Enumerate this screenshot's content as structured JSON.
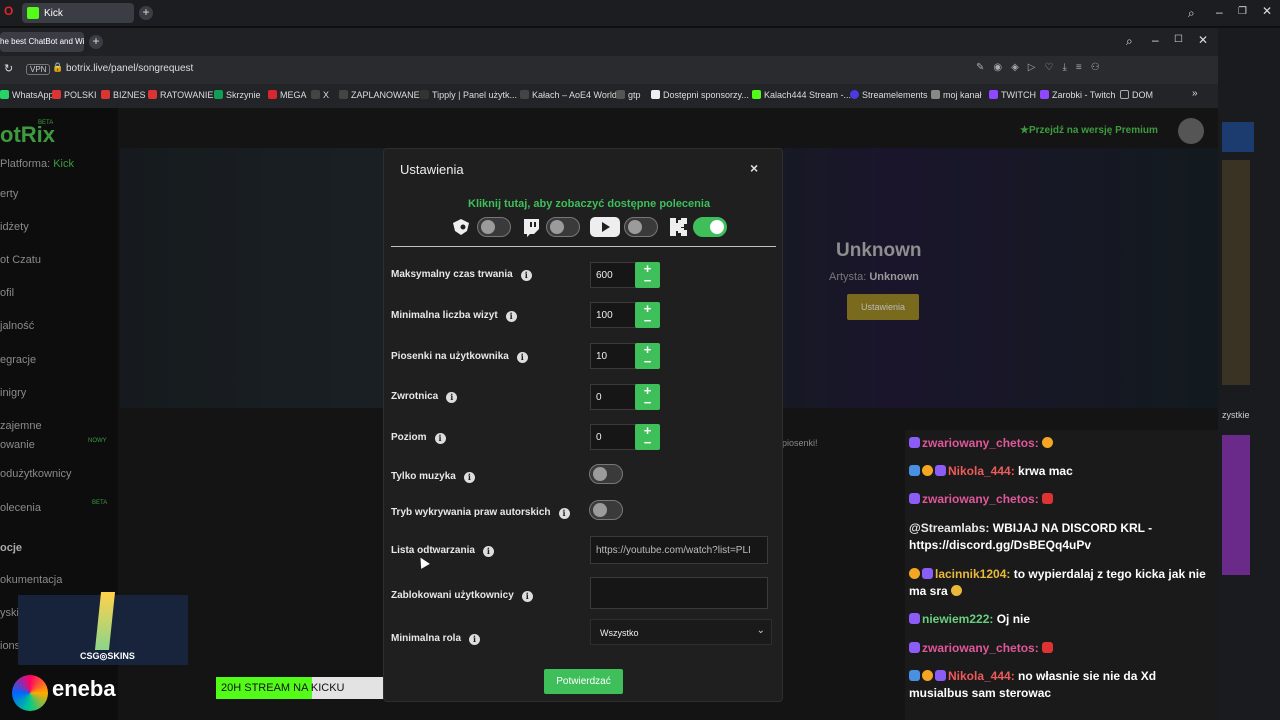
{
  "browser": {
    "tab_main": "Kick",
    "tab_secondary": "he best ChatBot and Wid",
    "url": "botrix.live/panel/songrequest",
    "vpn": "VPN"
  },
  "bookmarks": [
    "WhatsApp",
    "POLSKI",
    "BIZNES",
    "RATOWANIE",
    "Skrzynie",
    "MEGA",
    "X",
    "ZAPLANOWANE",
    "Tipply | Panel użytk...",
    "Kałach – AoE4 World",
    "gtp",
    "Dostępni sponsorzy...",
    "Kalach444 Stream -...",
    "Streamelements",
    "moj kanał",
    "TWITCH",
    "Zarobki - Twitch",
    "DOM"
  ],
  "sidebar": {
    "logo": "otRix",
    "logo_beta": "BETA",
    "platform_label": "Platforma:",
    "platform_value": "Kick",
    "items": [
      "erty",
      "idżety",
      "ot Czatu",
      "ofil",
      "jalność",
      "egracje",
      "inigry",
      "zajemne",
      "owanie",
      "odużytkownicy",
      "olecenia",
      "ocje",
      "okumentacja",
      "yski",
      "ions"
    ],
    "badge_nowy": "NOWY",
    "badge_beta": "BETA"
  },
  "header": {
    "premium": "Przejdź na wersję Premium"
  },
  "player": {
    "title": "Unknown",
    "artist_label": "Artysta:",
    "artist_value": "Unknown",
    "settings_button": "Ustawienia",
    "partial_text": "piosenki!"
  },
  "modal": {
    "title": "Ustawienia",
    "close": "×",
    "commands_link": "Kliknij tutaj, aby zobaczyć dostępne polecenia",
    "platforms": [
      {
        "name": "botrix",
        "enabled": false
      },
      {
        "name": "twitch",
        "enabled": false
      },
      {
        "name": "youtube",
        "enabled": false
      },
      {
        "name": "kick",
        "enabled": true
      }
    ],
    "fields": {
      "max_duration": {
        "label": "Maksymalny czas trwania",
        "value": "600"
      },
      "min_visits": {
        "label": "Minimalna liczba wizyt",
        "value": "100"
      },
      "songs_per_user": {
        "label": "Piosenki na użytkownika",
        "value": "10"
      },
      "cooldown": {
        "label": "Zwrotnica",
        "value": "0"
      },
      "level": {
        "label": "Poziom",
        "value": "0"
      },
      "music_only": {
        "label": "Tylko muzyka",
        "enabled": false
      },
      "copyright": {
        "label": "Tryb wykrywania praw autorskich",
        "enabled": false
      },
      "playlist": {
        "label": "Lista odtwarzania",
        "value": "https://youtube.com/watch?list=PLI"
      },
      "blocked_users": {
        "label": "Zablokowani użytkownicy",
        "value": ""
      },
      "min_role": {
        "label": "Minimalna rola",
        "value": "Wszystko"
      }
    },
    "plus": "+",
    "minus": "−",
    "info": "i",
    "confirm_button": "Potwierdzać",
    "chevron": "⌄"
  },
  "chat": {
    "wszystkie": "zystkie",
    "messages": [
      {
        "user": "zwariowany_chetos:",
        "text": ""
      },
      {
        "user": "Nikola_444:",
        "text": "krwa mac"
      },
      {
        "user": "zwariowany_chetos:",
        "text": ""
      },
      {
        "user": "@Streamlabs:",
        "text": "WBIJAJ NA DISCORD KRL - https://discord.gg/DsBEQq4uPv"
      },
      {
        "user": "lacinnik1204:",
        "text": "to wypierdalaj z tego kicka jak nie ma sra"
      },
      {
        "user": "niewiem222:",
        "text": "Oj nie"
      },
      {
        "user": "zwariowany_chetos:",
        "text": ""
      },
      {
        "user": "Nikola_444:",
        "text": "no własnie sie nie da Xd musialbus sam sterowac"
      }
    ]
  },
  "overlay": {
    "csgo": "CSG◎SKINS",
    "eneba": "eneba",
    "stream_goal": {
      "title": "20H STREAM NA KICKU",
      "current": "27",
      "max": "100",
      "progress": 0.27
    }
  },
  "colors": {
    "accent_green": "#3fbf5a",
    "kick_green": "#53fc18"
  }
}
